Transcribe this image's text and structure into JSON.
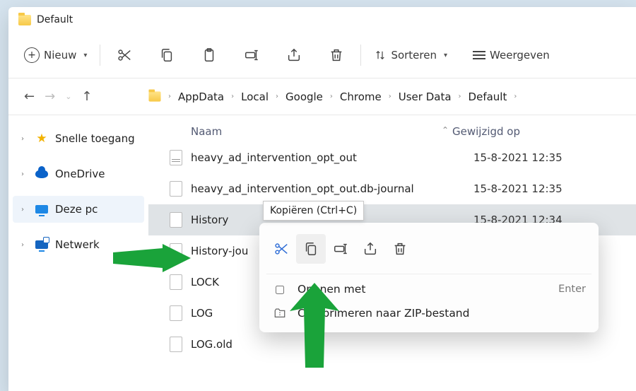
{
  "window": {
    "title": "Default"
  },
  "toolbar": {
    "new_label": "Nieuw",
    "sort_label": "Sorteren",
    "view_label": "Weergeven"
  },
  "breadcrumbs": [
    "AppData",
    "Local",
    "Google",
    "Chrome",
    "User Data",
    "Default"
  ],
  "sidebar": {
    "items": [
      {
        "label": "Snelle toegang"
      },
      {
        "label": "OneDrive"
      },
      {
        "label": "Deze pc"
      },
      {
        "label": "Netwerk"
      }
    ]
  },
  "columns": {
    "name": "Naam",
    "modified": "Gewijzigd op"
  },
  "files": [
    {
      "name": "heavy_ad_intervention_opt_out",
      "date": "15-8-2021 12:35",
      "type": "db"
    },
    {
      "name": "heavy_ad_intervention_opt_out.db-journal",
      "date": "15-8-2021 12:35",
      "type": "file"
    },
    {
      "name": "History",
      "date": "15-8-2021 12:34",
      "type": "file",
      "selected": true
    },
    {
      "name": "History-jou",
      "date": "",
      "type": "file"
    },
    {
      "name": "LOCK",
      "date": "",
      "type": "file"
    },
    {
      "name": "LOG",
      "date": "",
      "type": "file"
    },
    {
      "name": "LOG.old",
      "date": "",
      "type": "file"
    }
  ],
  "tooltip": {
    "text": "Kopiëren (Ctrl+C)"
  },
  "context_menu": {
    "open_with": "Openen met",
    "open_with_key": "Enter",
    "zip": "Comprimeren naar ZIP-bestand"
  }
}
